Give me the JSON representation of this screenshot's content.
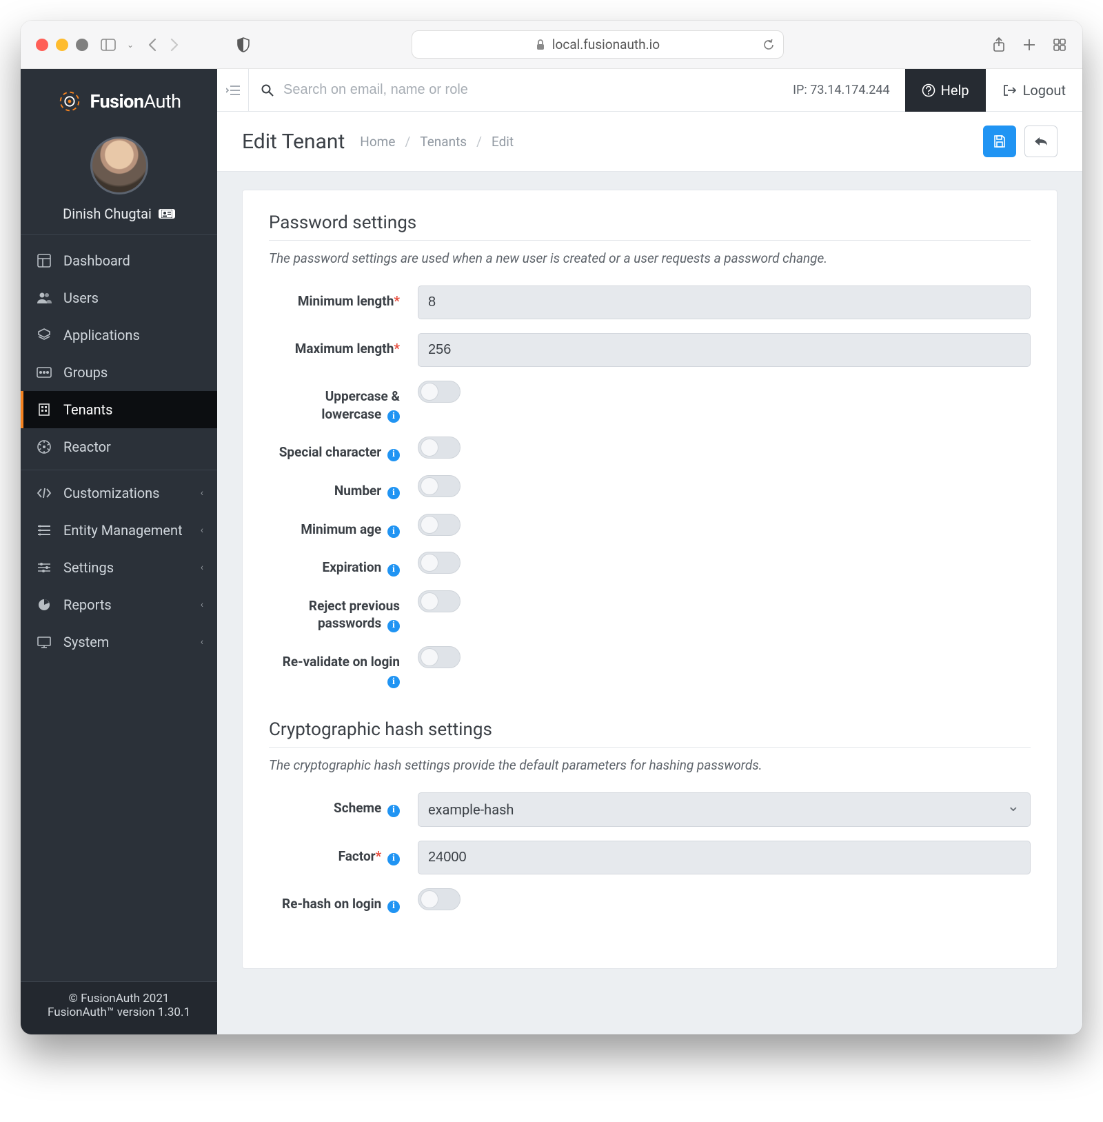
{
  "browser": {
    "url": "local.fusionauth.io"
  },
  "brand": {
    "name_a": "Fusion",
    "name_b": "Auth"
  },
  "user": {
    "name": "Dinish Chugtai"
  },
  "sidebar": {
    "items": [
      {
        "label": "Dashboard"
      },
      {
        "label": "Users"
      },
      {
        "label": "Applications"
      },
      {
        "label": "Groups"
      },
      {
        "label": "Tenants"
      },
      {
        "label": "Reactor"
      },
      {
        "label": "Customizations"
      },
      {
        "label": "Entity Management"
      },
      {
        "label": "Settings"
      },
      {
        "label": "Reports"
      },
      {
        "label": "System"
      }
    ]
  },
  "footer": {
    "line1": "© FusionAuth 2021",
    "line2": "FusionAuth™ version 1.30.1"
  },
  "topbar": {
    "search_placeholder": "Search on email, name or role",
    "ip_label": "IP: 73.14.174.244",
    "help": "Help",
    "logout": "Logout"
  },
  "header": {
    "title": "Edit Tenant",
    "crumb1": "Home",
    "crumb2": "Tenants",
    "crumb3": "Edit"
  },
  "pw_section": {
    "title": "Password settings",
    "hint": "The password settings are used when a new user is created or a user requests a password change.",
    "min_label": "Minimum length",
    "min_value": "8",
    "max_label": "Maximum length",
    "max_value": "256",
    "upper_label": "Uppercase & lowercase",
    "special_label": "Special character",
    "number_label": "Number",
    "minage_label": "Minimum age",
    "expiration_label": "Expiration",
    "reject_label": "Reject previous passwords",
    "revalidate_label": "Re-validate on login"
  },
  "hash_section": {
    "title": "Cryptographic hash settings",
    "hint": "The cryptographic hash settings provide the default parameters for hashing passwords.",
    "scheme_label": "Scheme",
    "scheme_value": "example-hash",
    "factor_label": "Factor",
    "factor_value": "24000",
    "rehash_label": "Re-hash on login"
  }
}
